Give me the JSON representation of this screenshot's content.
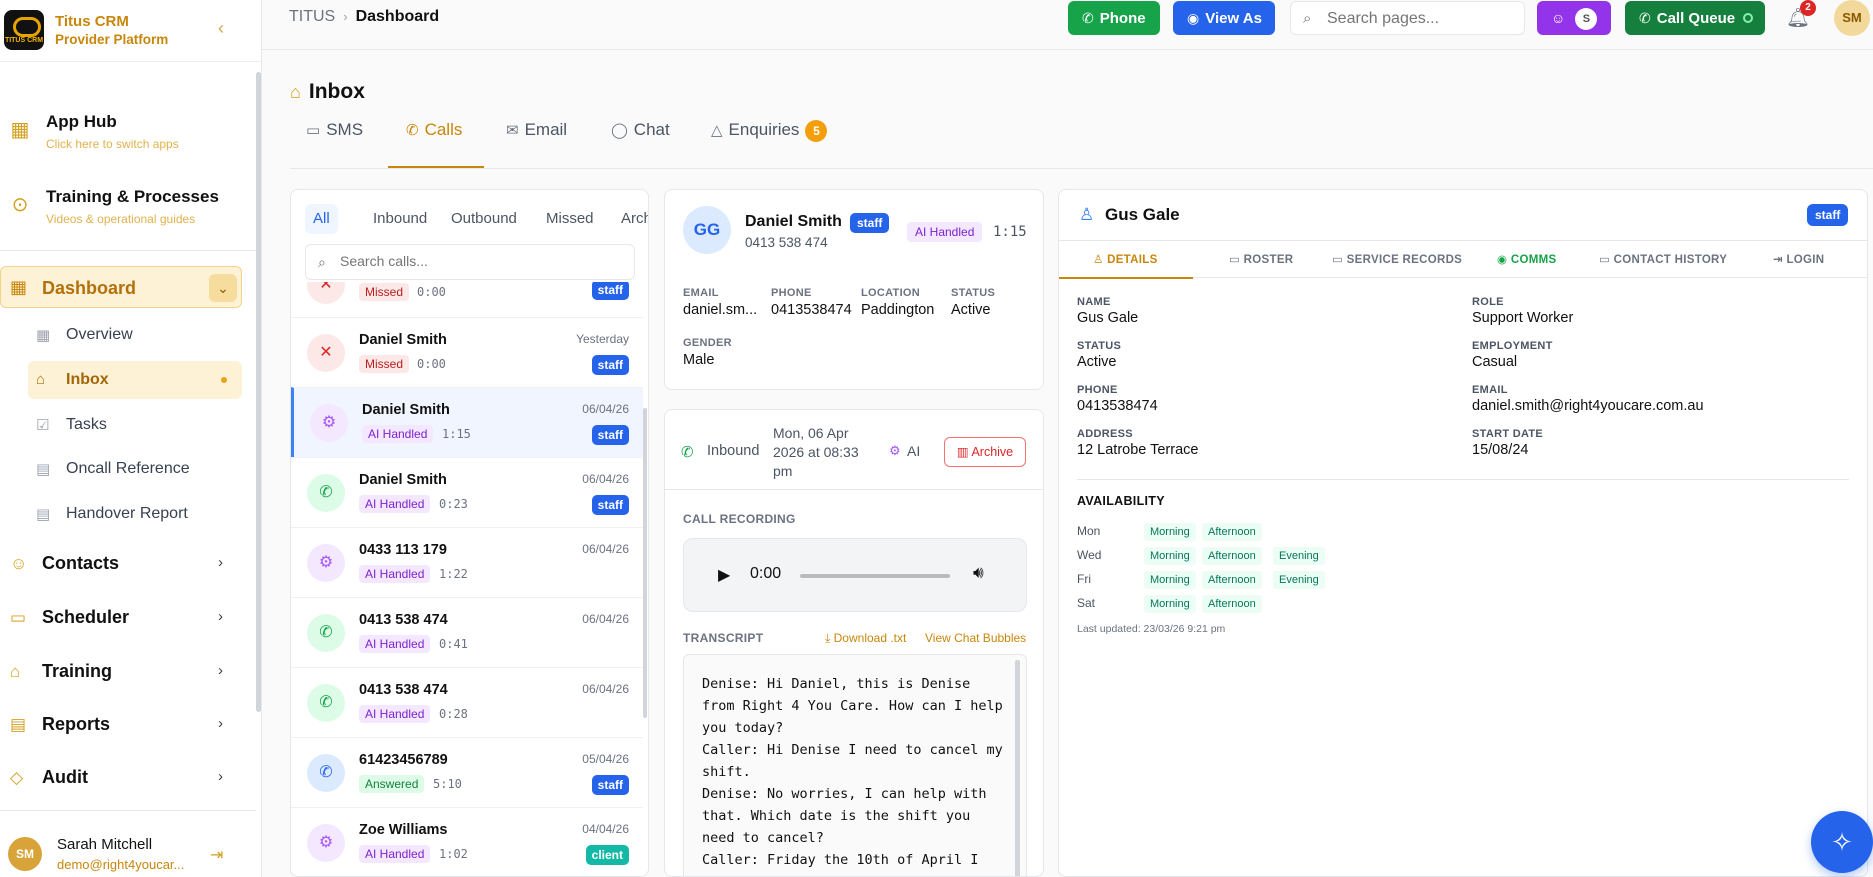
{
  "brand": {
    "logo_text": "TITUS CRM",
    "name": "Titus CRM",
    "subtitle": "Provider Platform"
  },
  "apps": [
    {
      "title": "App Hub",
      "subtitle": "Click here to switch apps"
    },
    {
      "title": "Training & Processes",
      "subtitle": "Videos & operational guides"
    }
  ],
  "nav": {
    "dashboard": "Dashboard",
    "sub": [
      "Overview",
      "Inbox",
      "Tasks",
      "Oncall Reference",
      "Handover Report"
    ],
    "sections": [
      "Contacts",
      "Scheduler",
      "Training",
      "Reports",
      "Audit"
    ]
  },
  "user": {
    "initials": "SM",
    "name": "Sarah Mitchell",
    "email": "demo@right4youcar..."
  },
  "breadcrumb": {
    "root": "TITUS",
    "current": "Dashboard"
  },
  "topbar": {
    "phone": "Phone",
    "view_as": "View As",
    "search_placeholder": "Search pages...",
    "team_initial": "S",
    "call_queue": "Call Queue",
    "notifications": "2",
    "avatar": "SM"
  },
  "inbox": {
    "title": "Inbox",
    "tabs": [
      "SMS",
      "Calls",
      "Email",
      "Chat",
      "Enquiries"
    ],
    "enquiries_count": "5"
  },
  "filters": [
    "All",
    "Inbound",
    "Outbound",
    "Missed",
    "Archived"
  ],
  "search_calls_placeholder": "Search calls...",
  "calls": [
    {
      "name": "",
      "status": "Missed",
      "duration": "0:00",
      "date": "",
      "tag": "staff"
    },
    {
      "name": "Daniel Smith",
      "status": "Missed",
      "duration": "0:00",
      "date": "Yesterday",
      "tag": "staff"
    },
    {
      "name": "Daniel Smith",
      "status": "AI Handled",
      "duration": "1:15",
      "date": "06/04/26",
      "tag": "staff"
    },
    {
      "name": "Daniel Smith",
      "status": "AI Handled",
      "duration": "0:23",
      "date": "06/04/26",
      "tag": "staff"
    },
    {
      "name": "0433 113 179",
      "status": "AI Handled",
      "duration": "1:22",
      "date": "06/04/26",
      "tag": ""
    },
    {
      "name": "0413 538 474",
      "status": "AI Handled",
      "duration": "0:41",
      "date": "06/04/26",
      "tag": ""
    },
    {
      "name": "0413 538 474",
      "status": "AI Handled",
      "duration": "0:28",
      "date": "06/04/26",
      "tag": ""
    },
    {
      "name": "61423456789",
      "status": "Answered",
      "duration": "5:10",
      "date": "05/04/26",
      "tag": "staff"
    },
    {
      "name": "Zoe Williams",
      "status": "AI Handled",
      "duration": "1:02",
      "date": "04/04/26",
      "tag": "client"
    }
  ],
  "caller": {
    "initials": "GG",
    "name": "Daniel Smith",
    "tag": "staff",
    "phone": "0413 538 474",
    "handled": "AI Handled",
    "duration": "1:15",
    "labels": {
      "email": "EMAIL",
      "phone": "PHONE",
      "location": "LOCATION",
      "status": "STATUS",
      "gender": "GENDER"
    },
    "email": "daniel.sm...",
    "phone_val": "0413538474",
    "location": "Paddington",
    "status": "Active",
    "gender": "Male"
  },
  "call": {
    "direction": "Inbound",
    "datetime": "Mon, 06 Apr 2026 at 08:33 pm",
    "ai": "AI",
    "archive": "Archive",
    "recording_label": "CALL RECORDING",
    "time": "0:00",
    "transcript_label": "TRANSCRIPT",
    "download": "Download .txt",
    "bubbles": "View Chat Bubbles",
    "transcript": "Denise: Hi Daniel, this is Denise from Right 4 You Care. How can I help you today?\nCaller: Hi Denise I need to cancel my shift.\nDenise: No worries, I can help with that. Which date is the shift you need to cancel?\nCaller: Friday the 10th of April I"
  },
  "contact": {
    "name": "Gus Gale",
    "tag": "staff",
    "tabs": [
      "DETAILS",
      "ROSTER",
      "SERVICE RECORDS",
      "COMMS",
      "CONTACT HISTORY",
      "LOGIN"
    ],
    "fields": {
      "name_l": "NAME",
      "name": "Gus Gale",
      "role_l": "ROLE",
      "role": "Support Worker",
      "status_l": "STATUS",
      "status": "Active",
      "employment_l": "EMPLOYMENT",
      "employment": "Casual",
      "phone_l": "PHONE",
      "phone": "0413538474",
      "email_l": "EMAIL",
      "email": "daniel.smith@right4youcare.com.au",
      "address_l": "ADDRESS",
      "address": "12 Latrobe Terrace",
      "start_l": "START DATE",
      "start": "15/08/24"
    },
    "availability_label": "AVAILABILITY",
    "availability": [
      {
        "day": "Mon",
        "slots": [
          "Morning",
          "Afternoon"
        ]
      },
      {
        "day": "Wed",
        "slots": [
          "Morning",
          "Afternoon",
          "Evening"
        ]
      },
      {
        "day": "Fri",
        "slots": [
          "Morning",
          "Afternoon",
          "Evening"
        ]
      },
      {
        "day": "Sat",
        "slots": [
          "Morning",
          "Afternoon"
        ]
      }
    ],
    "last_updated": "Last updated: 23/03/26 9:21 pm"
  },
  "colors": {
    "accent": "#c8860b",
    "phone_btn": "#16a34a",
    "view_as": "#2563eb",
    "team": "#9333ea",
    "call_queue": "#15803d"
  }
}
